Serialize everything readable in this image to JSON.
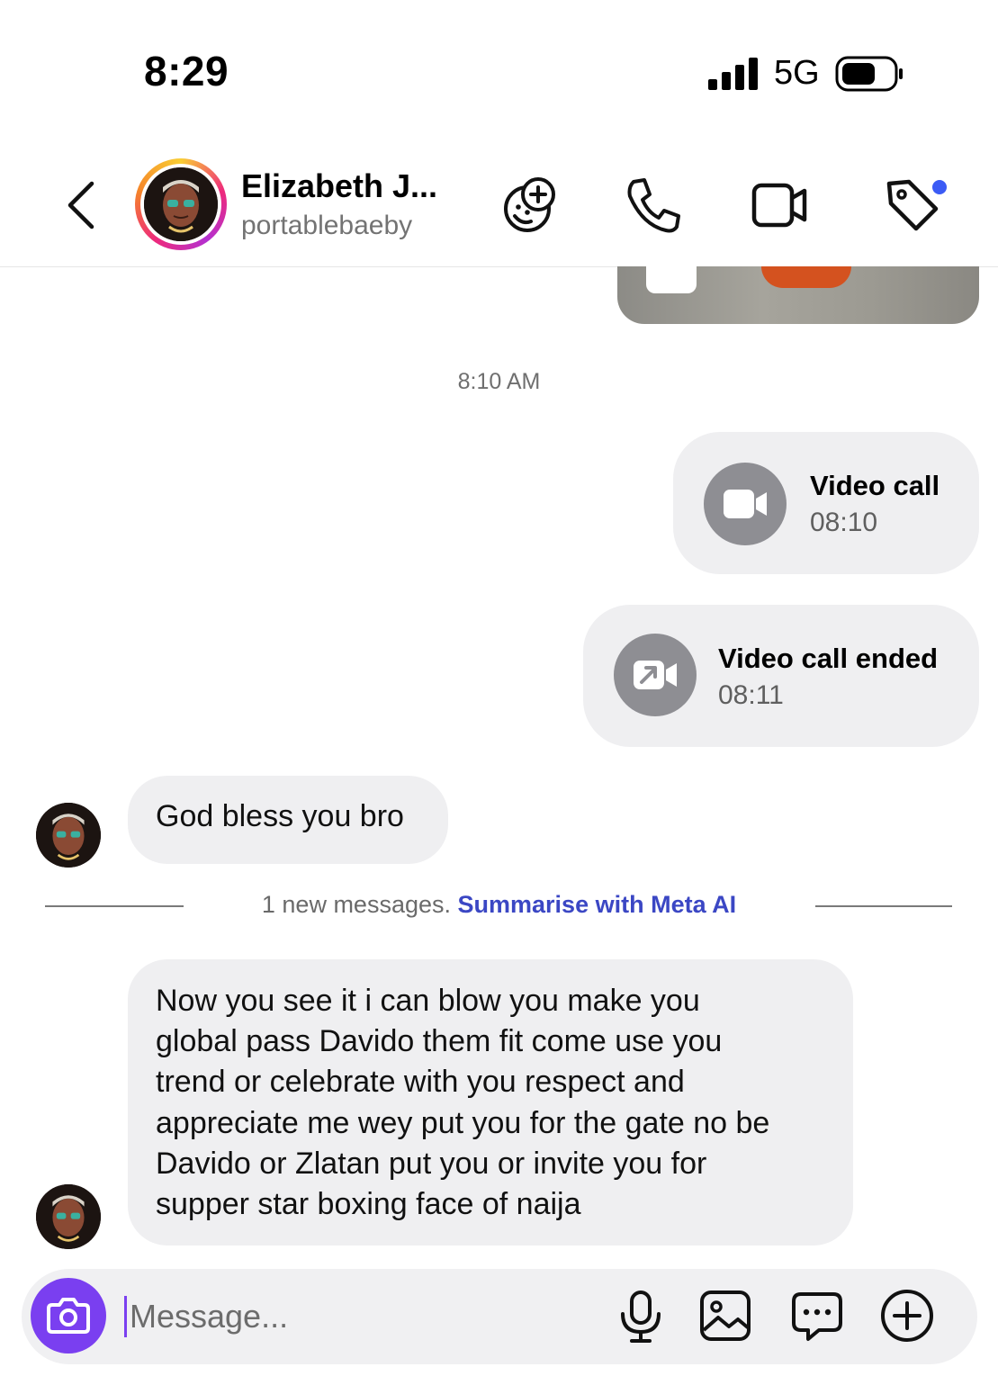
{
  "status_bar": {
    "time": "8:29",
    "network": "5G"
  },
  "header": {
    "contact_name": "Elizabeth J...",
    "username": "portablebaeby",
    "icons": [
      "back-icon",
      "add-sticker-icon",
      "phone-icon",
      "video-camera-icon",
      "tag-icon"
    ],
    "tag_dot_color": "#3b5bf5"
  },
  "chat": {
    "timestamp": "8:10 AM",
    "calls": [
      {
        "title": "Video call",
        "time": "08:10"
      },
      {
        "title": "Video call ended",
        "time": "08:11"
      }
    ],
    "messages": [
      {
        "text": "God bless you bro"
      },
      {
        "lines": [
          "Now you see it i can blow you make you",
          "global pass Davido them fit come use you",
          "trend or celebrate with you respect and",
          "appreciate me wey put you for the gate no be",
          "Davido or Zlatan put you or invite you for",
          "supper star boxing face of naija"
        ]
      }
    ],
    "new_messages": {
      "text": "1 new messages.",
      "link": "Summarise with Meta AI"
    }
  },
  "composer": {
    "placeholder": "Message...",
    "icons": [
      "camera-icon",
      "microphone-icon",
      "gallery-icon",
      "sticker-chat-icon",
      "plus-icon"
    ],
    "accent_color": "#7a3ff0"
  }
}
